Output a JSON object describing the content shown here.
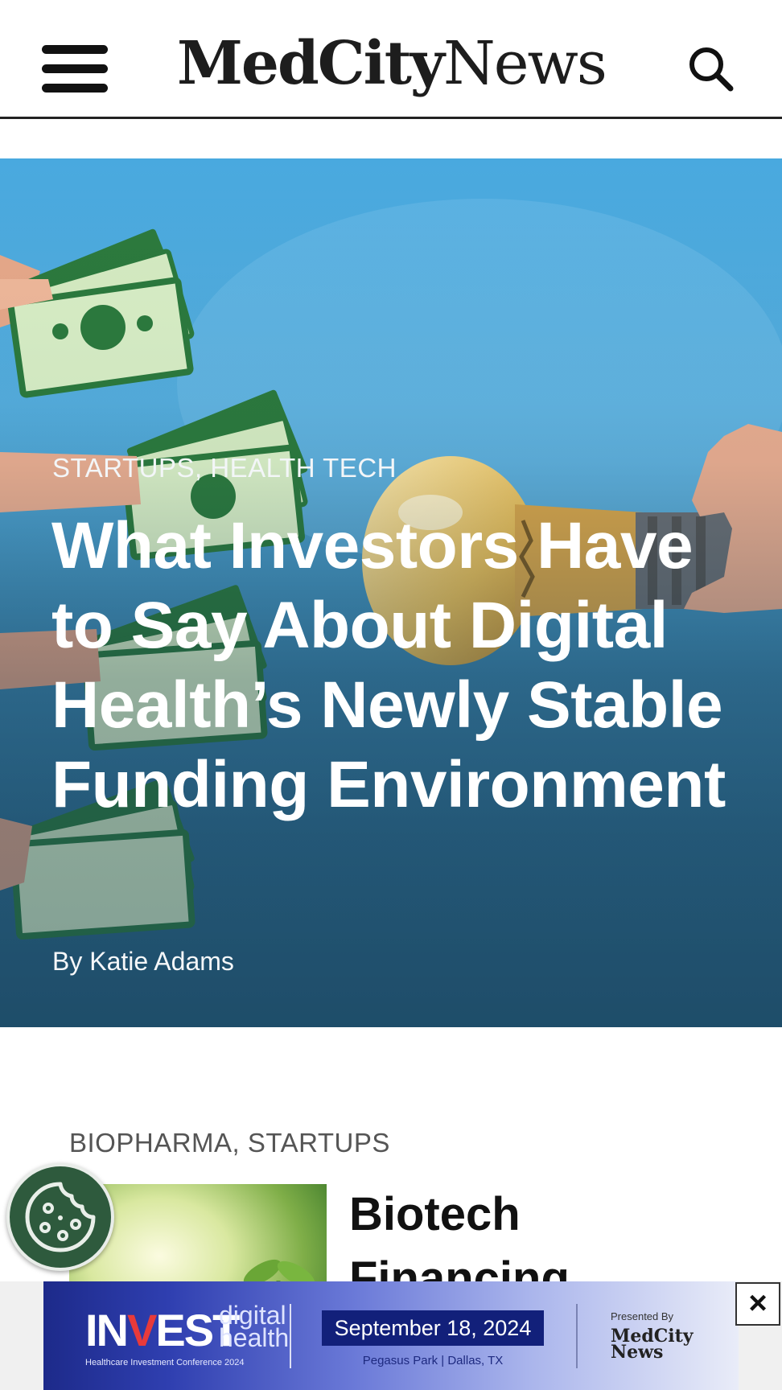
{
  "header": {
    "logo_bold": "MedCity",
    "logo_light": "News",
    "menu_icon": "hamburger-menu-icon",
    "search_icon": "search-icon"
  },
  "hero": {
    "categories": [
      "STARTUPS",
      "HEALTH TECH"
    ],
    "category_separator": ", ",
    "title": "What Investors Have to Say About Digital Health’s Newly Stable Funding Environment",
    "byline": "By Katie Adams",
    "image_icon": "money-lightbulb-illustration"
  },
  "second_article": {
    "categories": [
      "BIOPHARMA",
      "STARTUPS"
    ],
    "category_separator": ", ",
    "title": "Biotech Financing",
    "thumb_icon": "seedling-thumbnail"
  },
  "cookie": {
    "icon": "cookie-icon"
  },
  "ad": {
    "logo_invest_in": "IN",
    "logo_invest_v": "V",
    "logo_invest_est": "EST",
    "logo_digital": "digital",
    "logo_health": "health",
    "subtitle": "Healthcare Investment Conference 2024",
    "date": "September 18, 2024",
    "location": "Pegasus Park | Dallas, TX",
    "presented_by": "Presented By",
    "brand": "MedCity News",
    "close_label": "×"
  },
  "colors": {
    "hero_top": "#49a9df",
    "hero_bottom": "#275b7a",
    "cookie_bg": "#2e5a3d",
    "ad_dark": "#1d2a8a",
    "ad_date_bg": "#12207a"
  }
}
